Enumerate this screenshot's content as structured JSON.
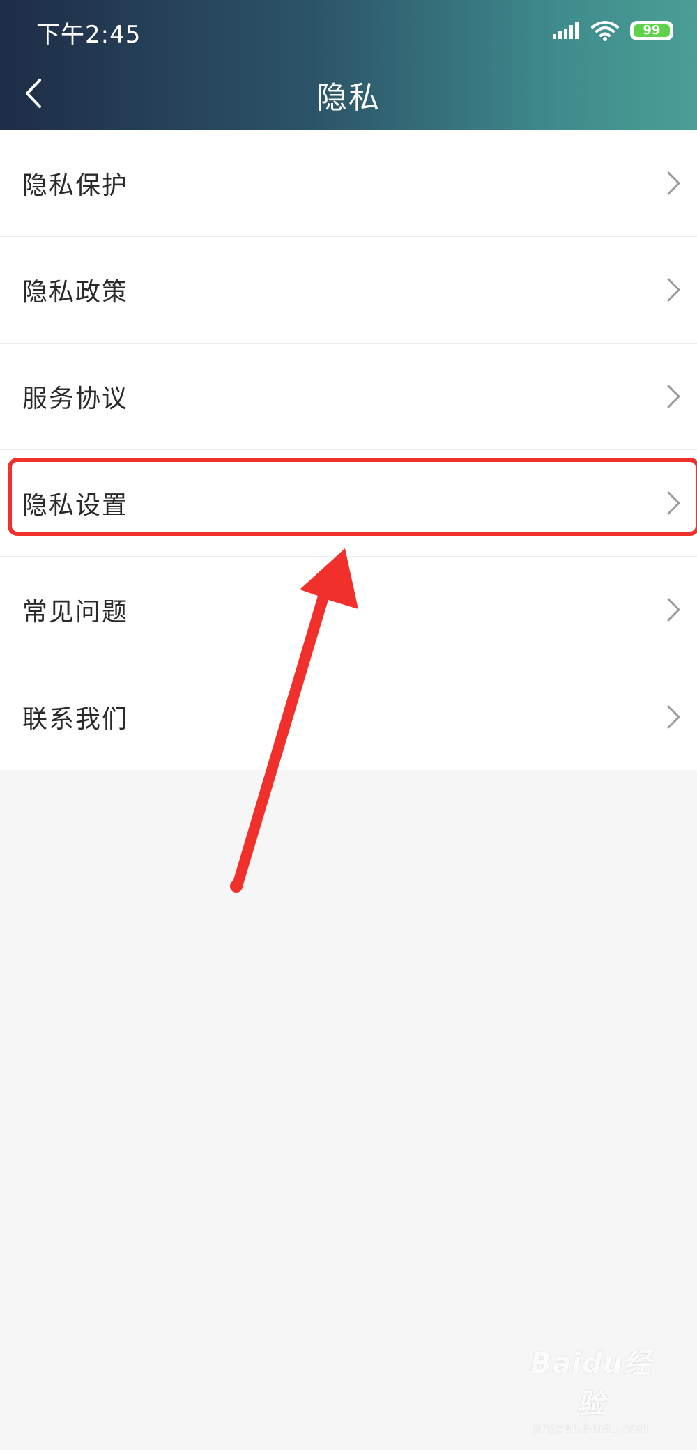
{
  "status_bar": {
    "time": "下午2:45",
    "battery_level": "99",
    "battery_color": "#5fd14b",
    "icons": [
      "signal-icon",
      "wifi-icon",
      "battery-icon"
    ]
  },
  "header": {
    "title": "隐私",
    "back_icon": "chevron-left-icon"
  },
  "menu": {
    "items": [
      {
        "label": "隐私保护"
      },
      {
        "label": "隐私政策"
      },
      {
        "label": "服务协议"
      },
      {
        "label": "隐私设置"
      },
      {
        "label": "常见问题"
      },
      {
        "label": "联系我们"
      }
    ],
    "chevron_icon": "chevron-right-icon",
    "highlighted_item": "隐私设置"
  },
  "annotation": {
    "color": "#f2302b",
    "shapes": [
      "highlight-box",
      "arrow"
    ]
  },
  "watermark": {
    "main": "Baidu经验",
    "sub": "jingyan.baidu.com"
  }
}
